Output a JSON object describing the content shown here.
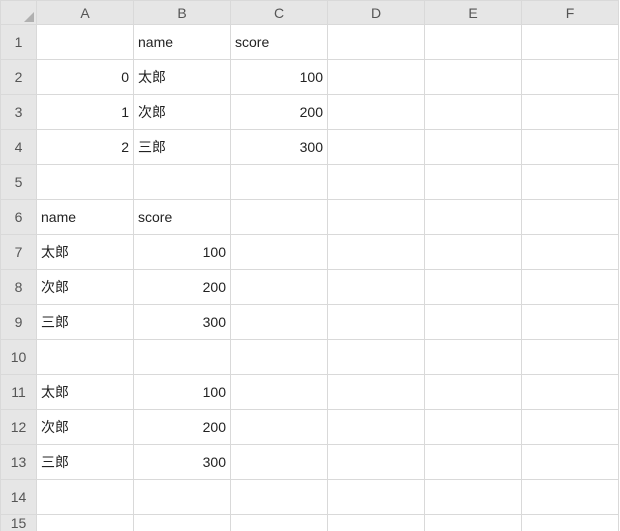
{
  "columns": [
    "A",
    "B",
    "C",
    "D",
    "E",
    "F"
  ],
  "rows": [
    "1",
    "2",
    "3",
    "4",
    "5",
    "6",
    "7",
    "8",
    "9",
    "10",
    "11",
    "12",
    "13",
    "14",
    "15"
  ],
  "cells": {
    "B1": "name",
    "C1": "score",
    "A2": "0",
    "B2": "太郎",
    "C2": "100",
    "A3": "1",
    "B3": "次郎",
    "C3": "200",
    "A4": "2",
    "B4": "三郎",
    "C4": "300",
    "A6": "name",
    "B6": "score",
    "A7": "太郎",
    "B7": "100",
    "A8": "次郎",
    "B8": "200",
    "A9": "三郎",
    "B9": "300",
    "A11": "太郎",
    "B11": "100",
    "A12": "次郎",
    "B12": "200",
    "A13": "三郎",
    "B13": "300"
  },
  "align": {
    "B1": "txt",
    "C1": "txt",
    "A2": "num",
    "B2": "txt",
    "C2": "num",
    "A3": "num",
    "B3": "txt",
    "C3": "num",
    "A4": "num",
    "B4": "txt",
    "C4": "num",
    "A6": "txt",
    "B6": "txt",
    "A7": "txt",
    "B7": "num",
    "A8": "txt",
    "B8": "num",
    "A9": "txt",
    "B9": "num",
    "A11": "txt",
    "B11": "num",
    "A12": "txt",
    "B12": "num",
    "A13": "txt",
    "B13": "num"
  }
}
